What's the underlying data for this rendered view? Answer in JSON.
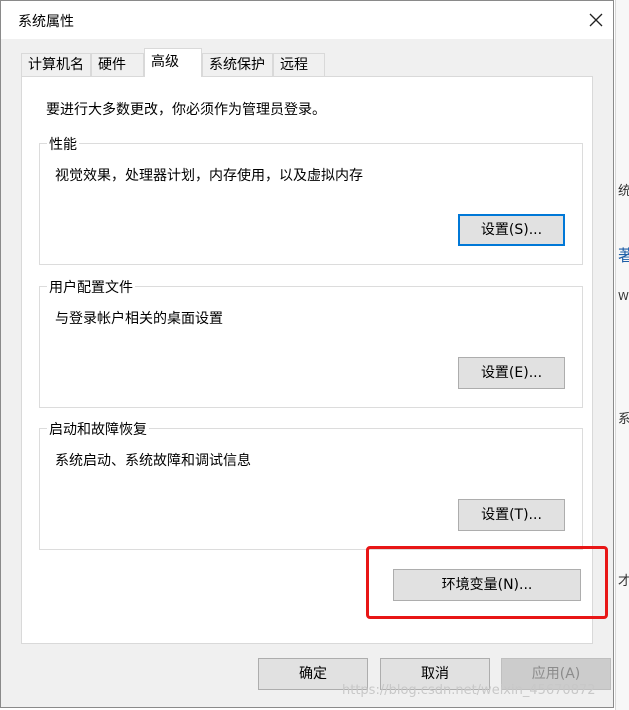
{
  "window": {
    "title": "系统属性"
  },
  "tabs": [
    {
      "label": "计算机名"
    },
    {
      "label": "硬件"
    },
    {
      "label": "高级"
    },
    {
      "label": "系统保护"
    },
    {
      "label": "远程"
    }
  ],
  "notice": "要进行大多数更改，你必须作为管理员登录。",
  "groups": {
    "performance": {
      "label": "性能",
      "description": "视觉效果，处理器计划，内存使用，以及虚拟内存",
      "button": "设置(S)..."
    },
    "user_profiles": {
      "label": "用户配置文件",
      "description": "与登录帐户相关的桌面设置",
      "button": "设置(E)..."
    },
    "startup_recovery": {
      "label": "启动和故障恢复",
      "description": "系统启动、系统故障和调试信息",
      "button": "设置(T)..."
    }
  },
  "env_button": "环境变量(N)...",
  "footer": {
    "ok": "确定",
    "cancel": "取消",
    "apply": "应用(A)"
  },
  "watermark": "https://blog.csdn.net/weixin_45670872",
  "background_glyphs": [
    "统",
    "著",
    "W",
    "系",
    "才"
  ],
  "colors": {
    "highlight_box": "#e81616",
    "focus_border": "#0078d7"
  }
}
